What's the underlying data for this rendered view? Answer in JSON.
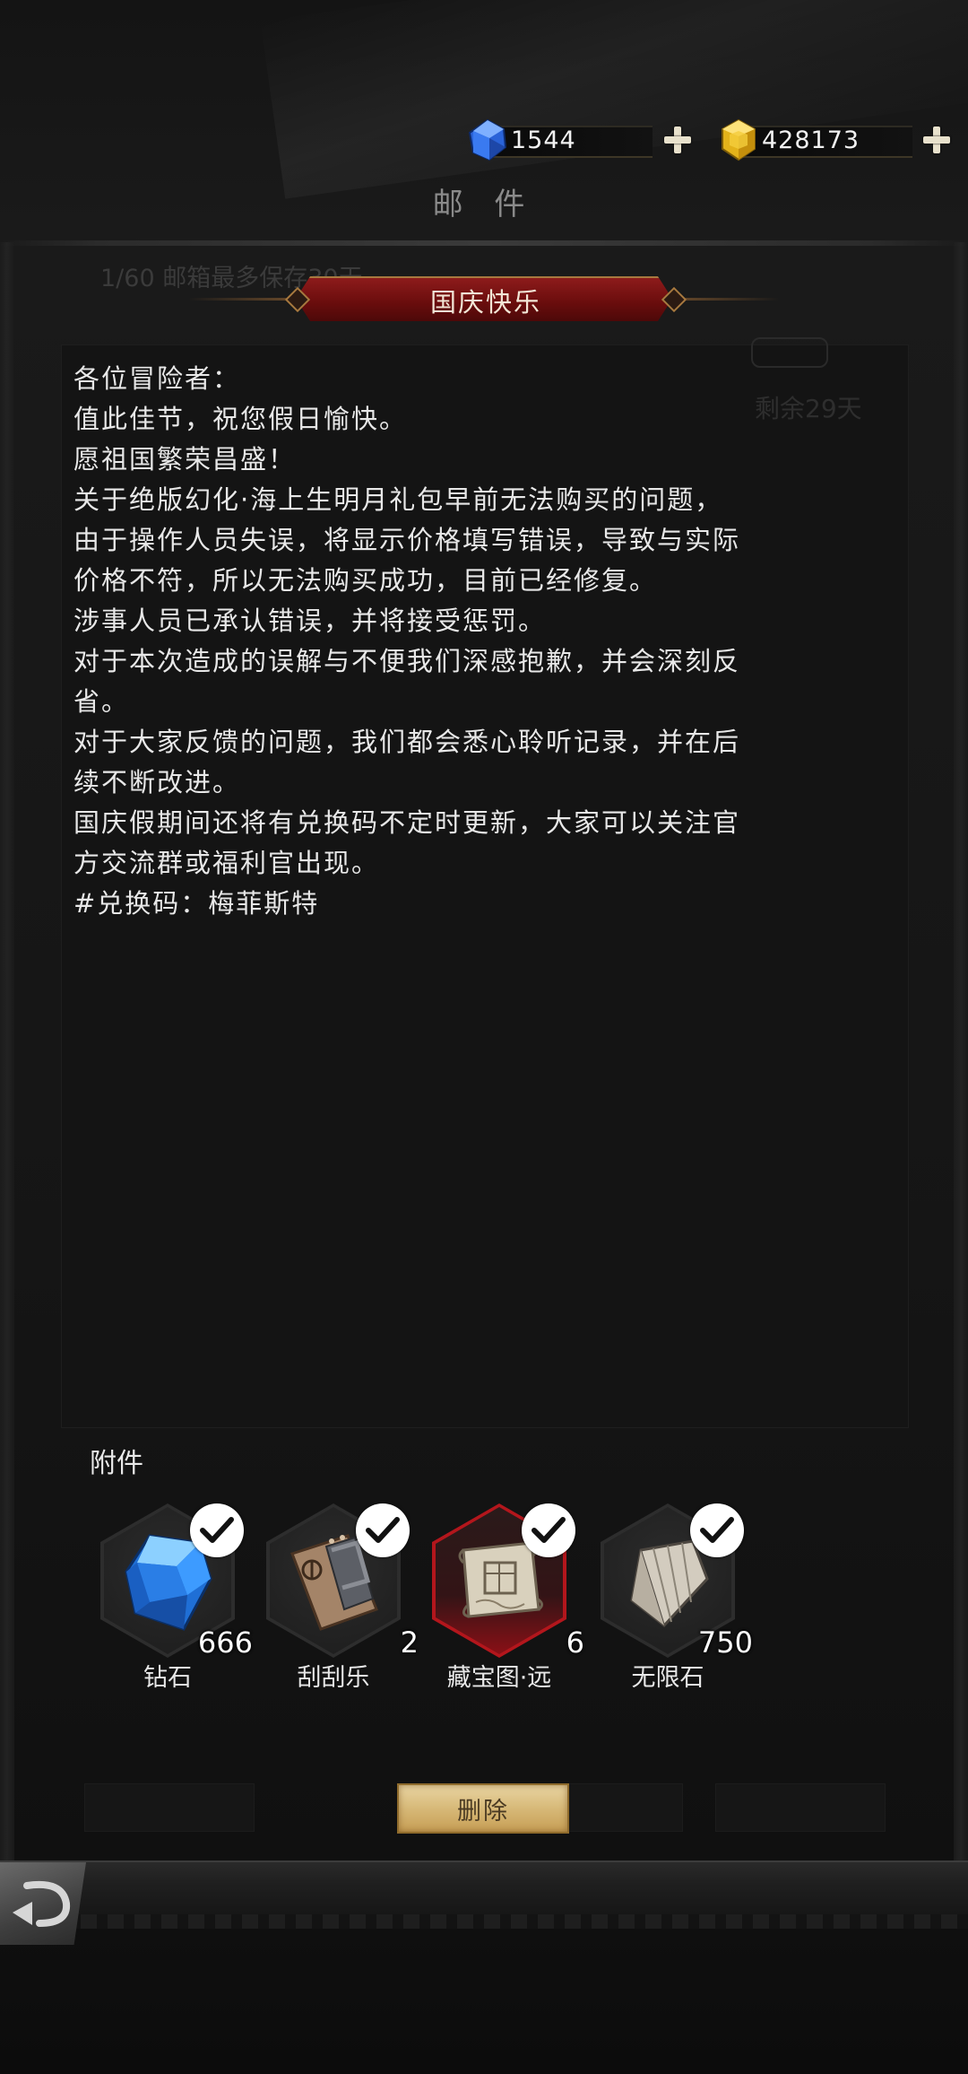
{
  "currencies": [
    {
      "name": "diamond",
      "value": "1544",
      "icon": "blue-gem-icon"
    },
    {
      "name": "gold",
      "value": "428173",
      "icon": "yellow-gem-icon"
    }
  ],
  "page": {
    "title": "邮 件",
    "ghost_count": "1/60 邮箱最多保存30天"
  },
  "mail": {
    "subject": "国庆快乐",
    "ghost_days": "剩余29天",
    "body": [
      "各位冒险者：",
      "值此佳节，祝您假日愉快。",
      "愿祖国繁荣昌盛！",
      "",
      "关于绝版幻化·海上生明月礼包早前无法购买的问题，",
      "由于操作人员失误，将显示价格填写错误，导致与实际",
      "价格不符，所以无法购买成功，目前已经修复。",
      "涉事人员已承认错误，并将接受惩罚。",
      "对于本次造成的误解与不便我们深感抱歉，并会深刻反",
      "省。",
      "对于大家反馈的问题，我们都会悉心聆听记录，并在后",
      "续不断改进。",
      "国庆假期间还将有兑换码不定时更新，大家可以关注官",
      "方交流群或福利官出现。",
      "#兑换码：梅菲斯特"
    ]
  },
  "attachments": {
    "label": "附件",
    "items": [
      {
        "name": "钻石",
        "qty": "666",
        "icon": "blue-diamond-icon",
        "highlight": false
      },
      {
        "name": "刮刮乐",
        "qty": "2",
        "icon": "scratch-card-icon",
        "highlight": false
      },
      {
        "name": "藏宝图·远",
        "qty": "6",
        "icon": "treasure-map-icon",
        "highlight": true
      },
      {
        "name": "无限石",
        "qty": "750",
        "icon": "stone-icon",
        "highlight": false
      }
    ]
  },
  "buttons": {
    "delete": "删除"
  },
  "colors": {
    "ribbon": "#7a1414",
    "button_gold": "#d7b978",
    "highlight_red": "#b3161c"
  }
}
